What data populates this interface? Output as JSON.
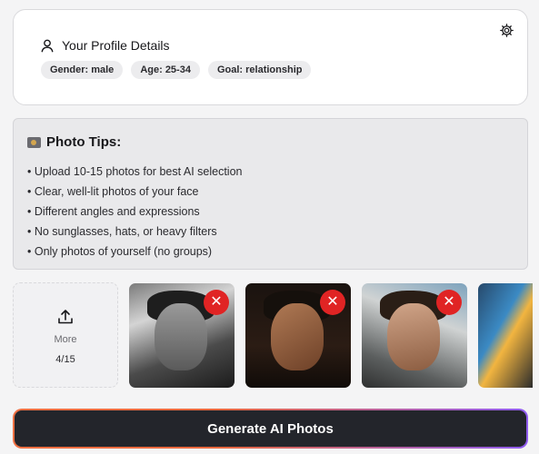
{
  "profile": {
    "title": "Your Profile Details",
    "chips": [
      "Gender: male",
      "Age: 25-34",
      "Goal: relationship"
    ]
  },
  "tips": {
    "title": "Photo Tips:",
    "items": [
      "• Upload 10-15 photos for best AI selection",
      "• Clear, well-lit photos of your face",
      "• Different angles and expressions",
      "• No sunglasses, hats, or heavy filters",
      "• Only photos of yourself (no groups)"
    ]
  },
  "upload": {
    "label": "More",
    "count": "4/15"
  },
  "photos": {
    "remove_symbol": "✕",
    "count_visible": 4
  },
  "generate": {
    "label": "Generate AI Photos"
  },
  "colors": {
    "remove_red": "#e02424",
    "button_dark": "#23252b",
    "gradient_orange": "#f07043",
    "gradient_purple": "#8f5cf0"
  },
  "icons": [
    "user-icon",
    "gear-icon",
    "camera-icon",
    "upload-icon",
    "close-icon"
  ]
}
